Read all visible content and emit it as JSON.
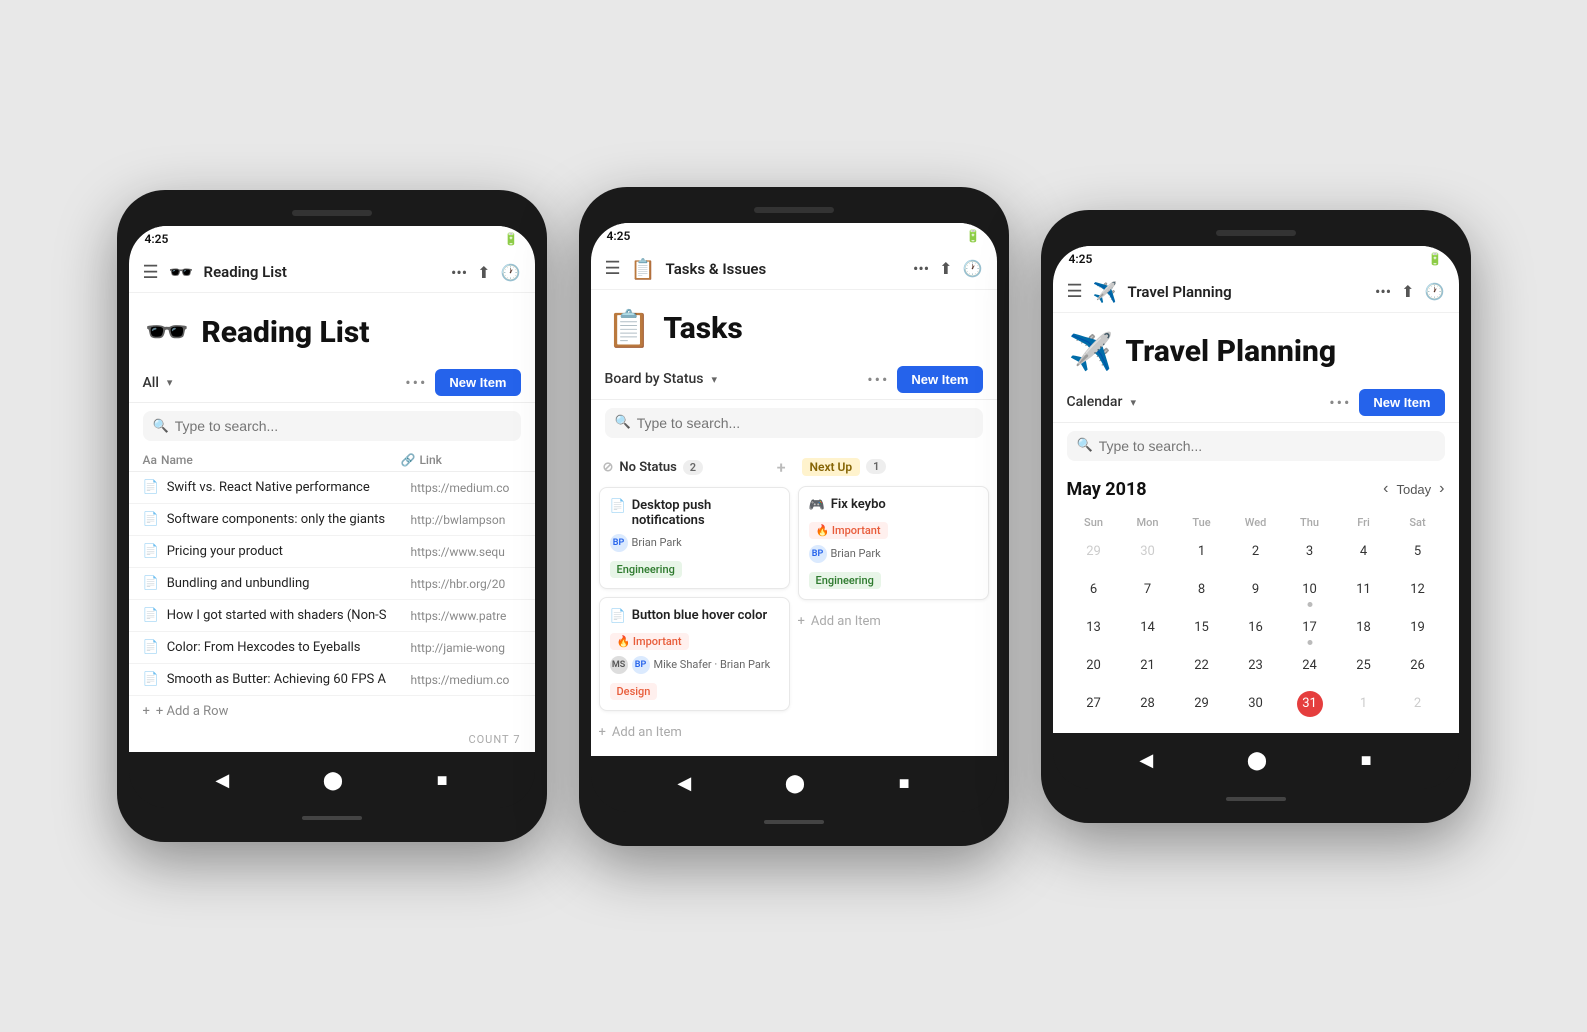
{
  "phones": [
    {
      "id": "reading-list",
      "statusTime": "4:25",
      "appBarMenu": "☰",
      "appBarIcon": "🕶️",
      "appBarTitle": "Reading List",
      "pageHeaderIcon": "🕶️",
      "pageHeaderTitle": "Reading List",
      "filterLabel": "All",
      "newItemLabel": "New Item",
      "searchPlaceholder": "Type to search...",
      "tableHeaders": {
        "name": "Name",
        "nameIcon": "Aa",
        "link": "Link",
        "linkIcon": "🔗"
      },
      "rows": [
        {
          "name": "Swift vs. React Native performance",
          "link": "https://medium.co"
        },
        {
          "name": "Software components: only the giants",
          "link": "http://bwlampson"
        },
        {
          "name": "Pricing your product",
          "link": "https://www.sequ"
        },
        {
          "name": "Bundling and unbundling",
          "link": "https://hbr.org/20"
        },
        {
          "name": "How I got started with shaders (Non-S",
          "link": "https://www.patre"
        },
        {
          "name": "Color: From Hexcodes to Eyeballs",
          "link": "http://jamie-wong"
        },
        {
          "name": "Smooth as Butter: Achieving 60 FPS A",
          "link": "https://medium.co"
        }
      ],
      "addRowLabel": "+ Add a Row",
      "countLabel": "COUNT",
      "countValue": "7"
    },
    {
      "id": "tasks",
      "statusTime": "4:25",
      "appBarMenu": "☰",
      "appBarIcon": "📋",
      "appBarTitle": "Tasks & Issues",
      "pageHeaderIcon": "📋",
      "pageHeaderTitle": "Tasks",
      "filterLabel": "Board by Status",
      "newItemLabel": "New Item",
      "searchPlaceholder": "Type to search...",
      "columns": [
        {
          "id": "no-status",
          "label": "No Status",
          "icon": "⊘",
          "count": "2",
          "cards": [
            {
              "title": "Desktop push notifications",
              "assignee": "Brian Park",
              "tag": "Engineering",
              "tagType": "engineering"
            },
            {
              "title": "Button blue hover color",
              "tag": "Important",
              "tagType": "important",
              "assignees": [
                "Mike Shafer",
                "Brian Park"
              ],
              "tag2": "Design",
              "tag2Type": "design"
            }
          ],
          "addLabel": "+ Add an Item"
        },
        {
          "id": "next-up",
          "label": "Next Up",
          "badge": "1",
          "cards": [
            {
              "title": "Fix keybo",
              "tag": "Important",
              "tagType": "important",
              "assignee": "Brian Park",
              "tag2": "Engineering",
              "tag2Type": "engineering"
            }
          ],
          "addLabel": "+ Add an Item"
        }
      ]
    },
    {
      "id": "travel-planning",
      "statusTime": "4:25",
      "appBarMenu": "☰",
      "appBarIcon": "✈️",
      "appBarTitle": "Travel Planning",
      "pageHeaderIcon": "✈️",
      "pageHeaderTitle": "Travel Planning",
      "filterLabel": "Calendar",
      "newItemLabel": "New Item",
      "searchPlaceholder": "Type to search...",
      "calendar": {
        "month": "May 2018",
        "todayLabel": "Today",
        "dayHeaders": [
          "Sun",
          "Mon",
          "Tue",
          "Wed",
          "Thu",
          "Fri",
          "Sat"
        ],
        "weeks": [
          [
            {
              "num": "29",
              "other": true
            },
            {
              "num": "30",
              "other": true
            },
            {
              "num": "1"
            },
            {
              "num": "2"
            },
            {
              "num": "3"
            },
            {
              "num": "4"
            },
            {
              "num": "5"
            }
          ],
          [
            {
              "num": "6"
            },
            {
              "num": "7"
            },
            {
              "num": "8"
            },
            {
              "num": "9"
            },
            {
              "num": "10",
              "dot": true
            },
            {
              "num": "11"
            },
            {
              "num": "12"
            }
          ],
          [
            {
              "num": "13"
            },
            {
              "num": "14"
            },
            {
              "num": "15"
            },
            {
              "num": "16"
            },
            {
              "num": "17",
              "dot": true
            },
            {
              "num": "18"
            },
            {
              "num": "19"
            }
          ],
          [
            {
              "num": "20"
            },
            {
              "num": "21"
            },
            {
              "num": "22"
            },
            {
              "num": "23"
            },
            {
              "num": "24"
            },
            {
              "num": "25"
            },
            {
              "num": "26"
            }
          ],
          [
            {
              "num": "27"
            },
            {
              "num": "28"
            },
            {
              "num": "29"
            },
            {
              "num": "30"
            },
            {
              "num": "31",
              "today": true
            },
            {
              "num": "1",
              "other": true
            },
            {
              "num": "2",
              "other": true
            }
          ]
        ]
      }
    }
  ]
}
